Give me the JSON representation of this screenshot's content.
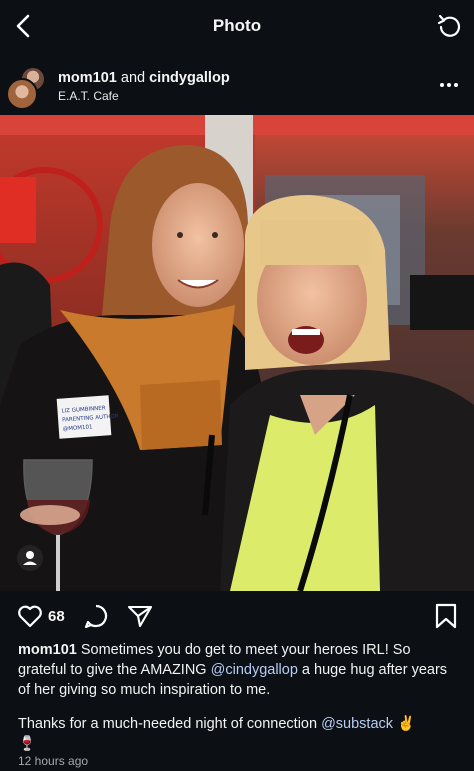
{
  "header": {
    "title": "Photo"
  },
  "post": {
    "author1": "mom101",
    "and": "and",
    "author2": "cindygallop",
    "location": "E.A.T. Cafe",
    "likes": "68",
    "caption_user": "mom101",
    "caption_part1": " Sometimes you do get to meet your heroes IRL! So grateful to give the AMAZING ",
    "mention1": "@cindygallop",
    "caption_part2": " a huge hug after years of her giving so much inspiration to me.",
    "caption_line2": "Thanks for a much-needed night of connection ",
    "mention2": "@substack",
    "emoji1": "✌️",
    "emoji2": "🍷",
    "timestamp": "12 hours ago",
    "name_tag": "LIZ GUMBINNER\nPARENTING AUTHOR\n@MOM101"
  },
  "icons": {
    "back": "chevron-left-icon",
    "refresh": "refresh-icon",
    "more": "more-horizontal-icon",
    "like": "heart-icon",
    "comment": "comment-icon",
    "share": "share-icon",
    "save": "bookmark-icon",
    "tag": "user-tag-icon"
  },
  "colors": {
    "background": "#0c1014",
    "mention": "#b7cdf5",
    "muted": "#a8a8a8"
  }
}
